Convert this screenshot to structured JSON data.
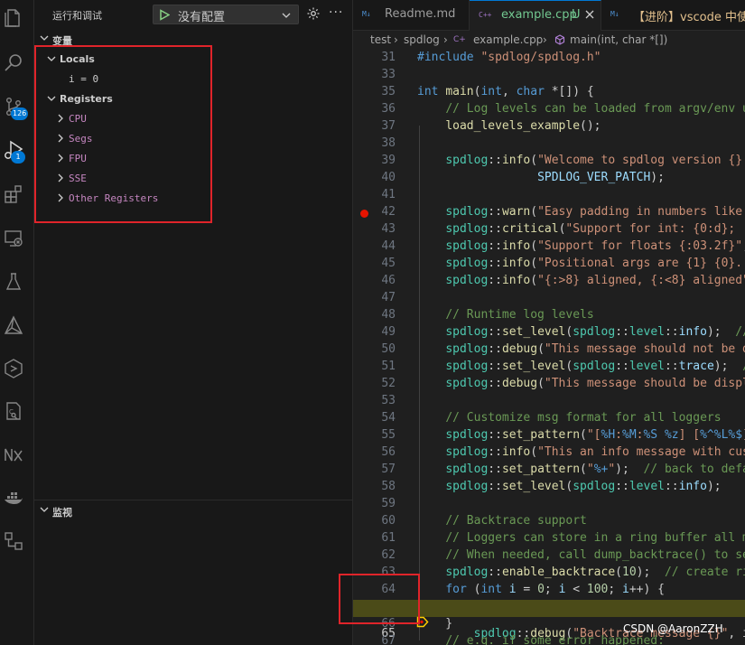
{
  "colors": {
    "accent": "#0078d4",
    "breakpoint": "#e51400",
    "current_line": "#4b4b18",
    "highlight": "#e0242a"
  },
  "activity_bar": {
    "icons": [
      "explorer-icon",
      "search-icon",
      "source-control-icon",
      "run-debug-icon",
      "extensions-icon",
      "remote-explorer-icon",
      "testing-icon",
      "cmake-icon",
      "kubernetes-icon",
      "c-cpp-icon",
      "nx-icon",
      "docker-icon",
      "gitgraph-icon"
    ],
    "source_control_badge": "126",
    "debug_badge": "1"
  },
  "sidebar": {
    "title": "运行和调试",
    "config_label": "没有配置",
    "variables_header": "变量",
    "locals_label": "Locals",
    "local_var": "i = 0",
    "registers_label": "Registers",
    "registers": [
      "CPU",
      "Segs",
      "FPU",
      "SSE",
      "Other Registers"
    ],
    "watch_header": "监视"
  },
  "editor": {
    "tabs": [
      {
        "label": "Readme.md",
        "icon": "M↓"
      },
      {
        "label": "example.cpp",
        "status": "U",
        "icon": "C++"
      },
      {
        "label": "【进阶】vscode 中使",
        "icon": "M↓"
      }
    ],
    "breadcrumb": [
      "test",
      "spdlog",
      "example.cpp",
      "main(int, char *[])"
    ],
    "breakpoint_line": "42",
    "current_line": "65"
  },
  "watermark": "CSDN @AaronZZH"
}
